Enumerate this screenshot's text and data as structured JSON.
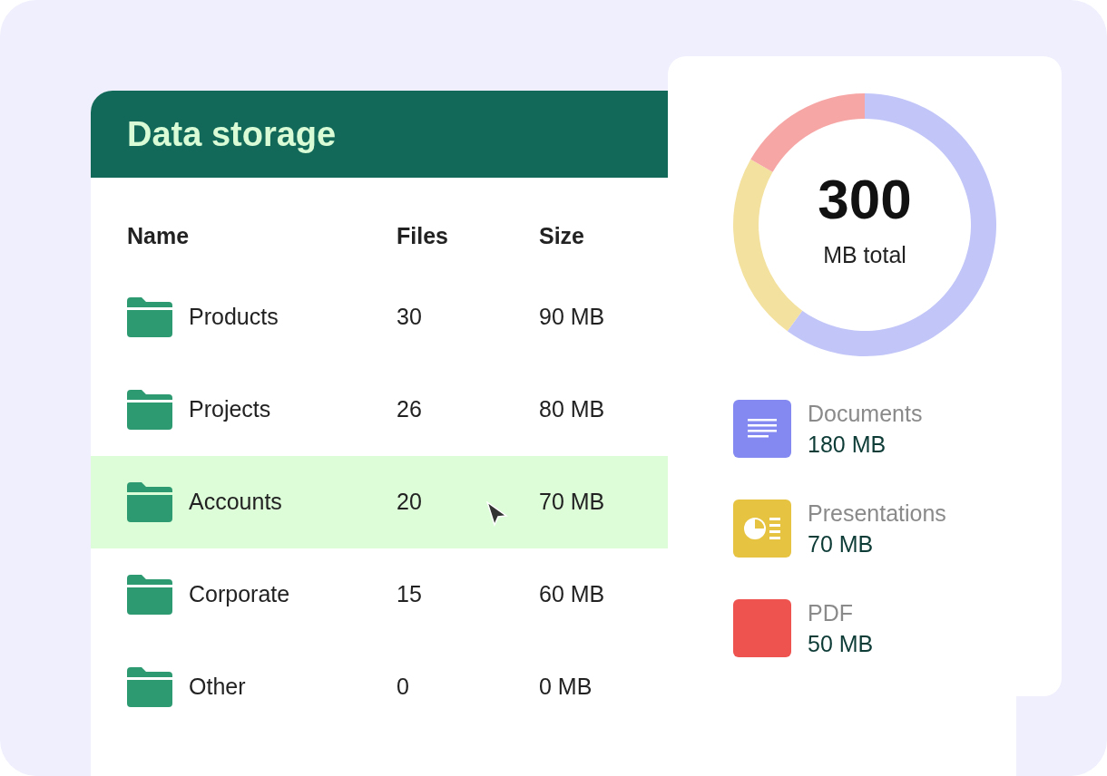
{
  "title": "Data storage",
  "table": {
    "columns": [
      "Name",
      "Files",
      "Size"
    ],
    "rows": [
      {
        "name": "Products",
        "files": "30",
        "size": "90 MB",
        "selected": false
      },
      {
        "name": "Projects",
        "files": "26",
        "size": "80 MB",
        "selected": false
      },
      {
        "name": "Accounts",
        "files": "20",
        "size": "70 MB",
        "selected": true
      },
      {
        "name": "Corporate",
        "files": "15",
        "size": "60 MB",
        "selected": false
      },
      {
        "name": "Other",
        "files": "0",
        "size": "0 MB",
        "selected": false
      }
    ]
  },
  "summary": {
    "total": "300",
    "total_label": "MB total",
    "chart_data": {
      "type": "donut",
      "categories": [
        "Documents",
        "Presentations",
        "PDF"
      ],
      "series": [
        {
          "values": [
            60,
            23.3,
            16.7
          ]
        }
      ],
      "colors": [
        "#c1c5f8",
        "#f3e19f",
        "#f7a6a6"
      ]
    },
    "legend": [
      {
        "kind": "documents",
        "value": "180 MB",
        "color": "#8389f0"
      },
      {
        "kind": "presentations",
        "value": "70 MB",
        "color": "#e6c341"
      },
      {
        "kind": "pdf",
        "value": "50 MB",
        "color": "#ee5350"
      }
    ]
  }
}
